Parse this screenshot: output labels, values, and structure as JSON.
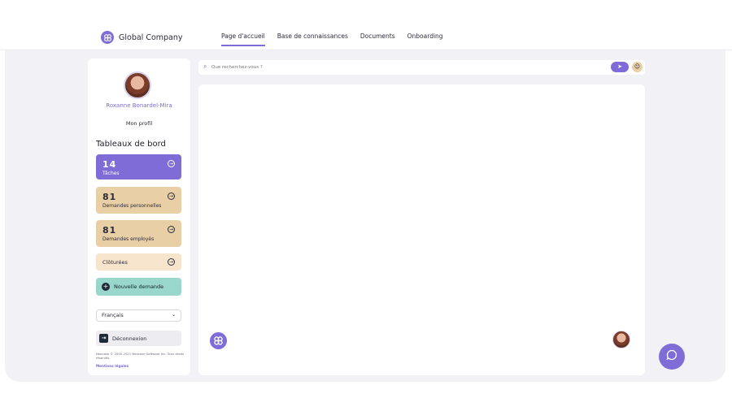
{
  "brand": {
    "name": "Global Company",
    "logo_icon": "flower-logo-icon"
  },
  "nav": [
    {
      "label": "Page d'accueil",
      "active": true
    },
    {
      "label": "Base de connaissances",
      "active": false
    },
    {
      "label": "Documents",
      "active": false
    },
    {
      "label": "Onboarding",
      "active": false
    }
  ],
  "user": {
    "name": "Roxanne Bonardel-Mira",
    "profile_link": "Mon profil"
  },
  "dashboard": {
    "title": "Tableaux de bord",
    "cards": [
      {
        "count": "14",
        "label": "Tâches"
      },
      {
        "count": "81",
        "label": "Demandes personnelles"
      },
      {
        "count": "81",
        "label": "Demandes employés"
      },
      {
        "label": "Clôturées"
      }
    ]
  },
  "new_request": {
    "label": "Nouvelle demande"
  },
  "language": {
    "selected": "Français"
  },
  "logout": {
    "label": "Déconnexion"
  },
  "footer": {
    "copyright": "Neocase © 2000-2021 Neocase Software Inc. Tous droits réservés.",
    "legal": "Mentions légales"
  },
  "search": {
    "placeholder": "Que recherchez-vous ?"
  },
  "colors": {
    "accent": "#7f6cd6",
    "sand": "#e9cfa6",
    "mint": "#99d6cc",
    "panel_bg": "#f1f1f6"
  }
}
